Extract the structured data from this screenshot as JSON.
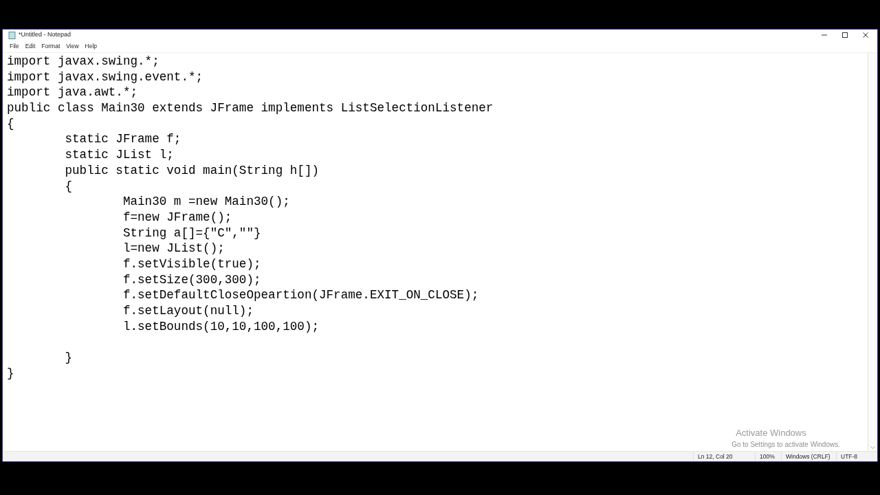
{
  "window": {
    "title": "*Untitled - Notepad"
  },
  "menu": [
    "File",
    "Edit",
    "Format",
    "View",
    "Help"
  ],
  "editor": {
    "lines": [
      {
        "kind": "code",
        "text": "import javax.swing.*;"
      },
      {
        "kind": "code",
        "text": "import javax.swing.event.*;"
      },
      {
        "kind": "code",
        "text": "import java.awt.*;"
      },
      {
        "kind": "code",
        "text": "public class Main30 extends JFrame implements ListSelectionListener"
      },
      {
        "kind": "code",
        "text": "{"
      },
      {
        "kind": "code",
        "text": "\tstatic JFrame f;"
      },
      {
        "kind": "code",
        "text": "\tstatic JList l;"
      },
      {
        "kind": "code",
        "text": "\tpublic static void main(String h[])"
      },
      {
        "kind": "code",
        "text": "\t{"
      },
      {
        "kind": "code",
        "text": "\t\tMain30 m =new Main30();"
      },
      {
        "kind": "code",
        "text": "\t\tf=new JFrame();"
      },
      {
        "kind": "code",
        "text": "\t\tString a[]={\"C\",\"\"}"
      },
      {
        "kind": "code",
        "text": "\t\tl=new JList();"
      },
      {
        "kind": "code",
        "text": "\t\tf.setVisible(true);"
      },
      {
        "kind": "code",
        "text": "\t\tf.setSize(300,300);"
      },
      {
        "kind": "code",
        "text": "\t\tf.setDefaultCloseOpeartion(JFrame.EXIT_ON_CLOSE);"
      },
      {
        "kind": "code",
        "text": "\t\tf.setLayout(null);"
      },
      {
        "kind": "code",
        "text": "\t\tl.setBounds(10,10,100,100);"
      },
      {
        "kind": "blank"
      },
      {
        "kind": "code",
        "text": "\t}"
      },
      {
        "kind": "code",
        "text": "}"
      }
    ]
  },
  "activation_notice": {
    "title": "Activate Windows",
    "subtitle": "Go to Settings to activate Windows."
  },
  "status_bar": [
    "Ln 12, Col 20",
    "100%",
    "Windows (CRLF)",
    "UTF-8"
  ]
}
